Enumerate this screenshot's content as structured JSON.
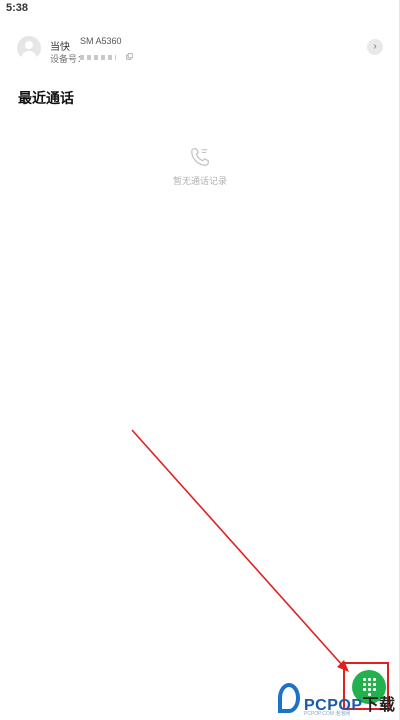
{
  "status_bar": {
    "time": "5:38"
  },
  "device": {
    "app_name": "当快",
    "model": "SM A5360",
    "id_label": "设备号：",
    "avatar_icon": "user-avatar-icon",
    "copy_icon": "copy-icon",
    "chevron_icon": "chevron-right-icon"
  },
  "recent_calls": {
    "title": "最近通话",
    "empty_icon": "phone-call-icon",
    "empty_text": "暂无通话记录"
  },
  "fab": {
    "icon": "dialpad-icon",
    "color": "#22b14c"
  },
  "annotation": {
    "arrow_color": "#e02020",
    "box_color": "#e02020"
  },
  "watermark": {
    "brand": "PCPOP",
    "suffix": "下载",
    "sub": "PCPOP.COM 泡泡网"
  }
}
